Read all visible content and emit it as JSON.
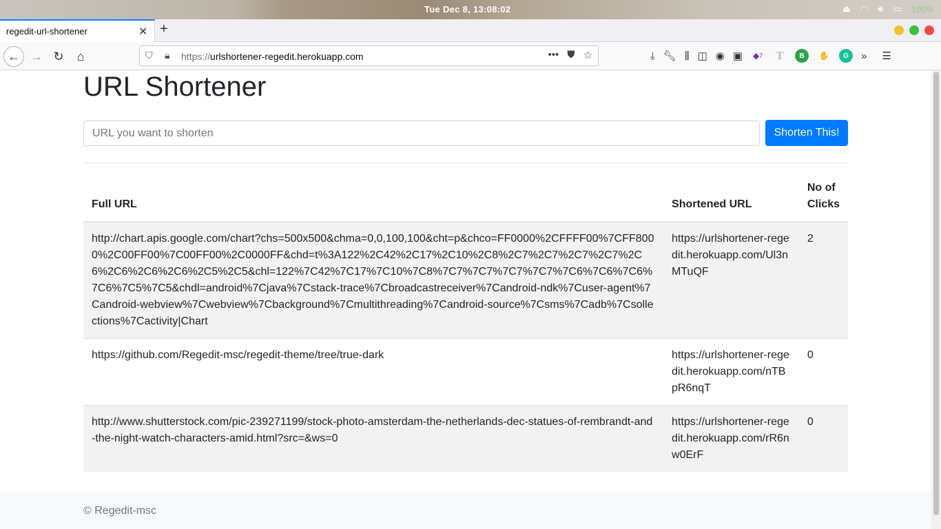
{
  "os": {
    "clock": "Tue Dec  8, 13:08:02",
    "battery": "100%",
    "colors": {
      "battery_text": "#8fd18f"
    }
  },
  "browser": {
    "tab_title": "regedit-url-shortener",
    "url_protocol": "https://",
    "url_host": "urlshortener-regedit.herokuapp.com",
    "ext_badge_count": "7",
    "ext_b_label": "B",
    "ext_g_label": "G",
    "ext_t_label": "T",
    "icons": [
      "back-icon",
      "forward-icon",
      "reload-icon",
      "home-icon",
      "shield-icon",
      "lock-icon",
      "more-icon",
      "pocket-icon",
      "star-icon",
      "download-icon",
      "wrench-icon",
      "library-icon",
      "sidebar-icon",
      "account-icon",
      "menu-icon"
    ]
  },
  "page": {
    "title": "URL Shortener",
    "input_placeholder": "URL you want to shorten",
    "button_label": "Shorten This!",
    "accent_color": "#007bff",
    "table": {
      "headers": {
        "full_url": "Full URL",
        "shortened_url": "Shortened URL",
        "clicks": "No of Clicks"
      },
      "rows": [
        {
          "full_url": "http://chart.apis.google.com/chart?chs=500x500&chma=0,0,100,100&cht=p&chco=FF0000%2CFFFF00%7CFF8000%2C00FF00%7C00FF00%2C0000FF&chd=t%3A122%2C42%2C17%2C10%2C8%2C7%2C7%2C7%2C7%2C6%2C6%2C6%2C6%2C5%2C5&chl=122%7C42%7C17%7C10%7C8%7C7%7C7%7C7%7C7%7C6%7C6%7C6%7C6%7C5%7C5&chdl=android%7Cjava%7Cstack-trace%7Cbroadcastreceiver%7Candroid-ndk%7Cuser-agent%7Candroid-webview%7Cwebview%7Cbackground%7Cmultithreading%7Candroid-source%7Csms%7Cadb%7Csollections%7Cactivity|Chart",
          "short_url": "https://urlshortener-regedit.herokuapp.com/Ul3nMTuQF",
          "clicks": "2"
        },
        {
          "full_url": "https://github.com/Regedit-msc/regedit-theme/tree/true-dark",
          "short_url": "https://urlshortener-regedit.herokuapp.com/nTBpR6nqT",
          "clicks": "0"
        },
        {
          "full_url": "http://www.shutterstock.com/pic-239271199/stock-photo-amsterdam-the-netherlands-dec-statues-of-rembrandt-and-the-night-watch-characters-amid.html?src=&ws=0",
          "short_url": "https://urlshortener-regedit.herokuapp.com/rR6nw0ErF",
          "clicks": "0"
        }
      ]
    },
    "footer": "© Regedit-msc"
  }
}
